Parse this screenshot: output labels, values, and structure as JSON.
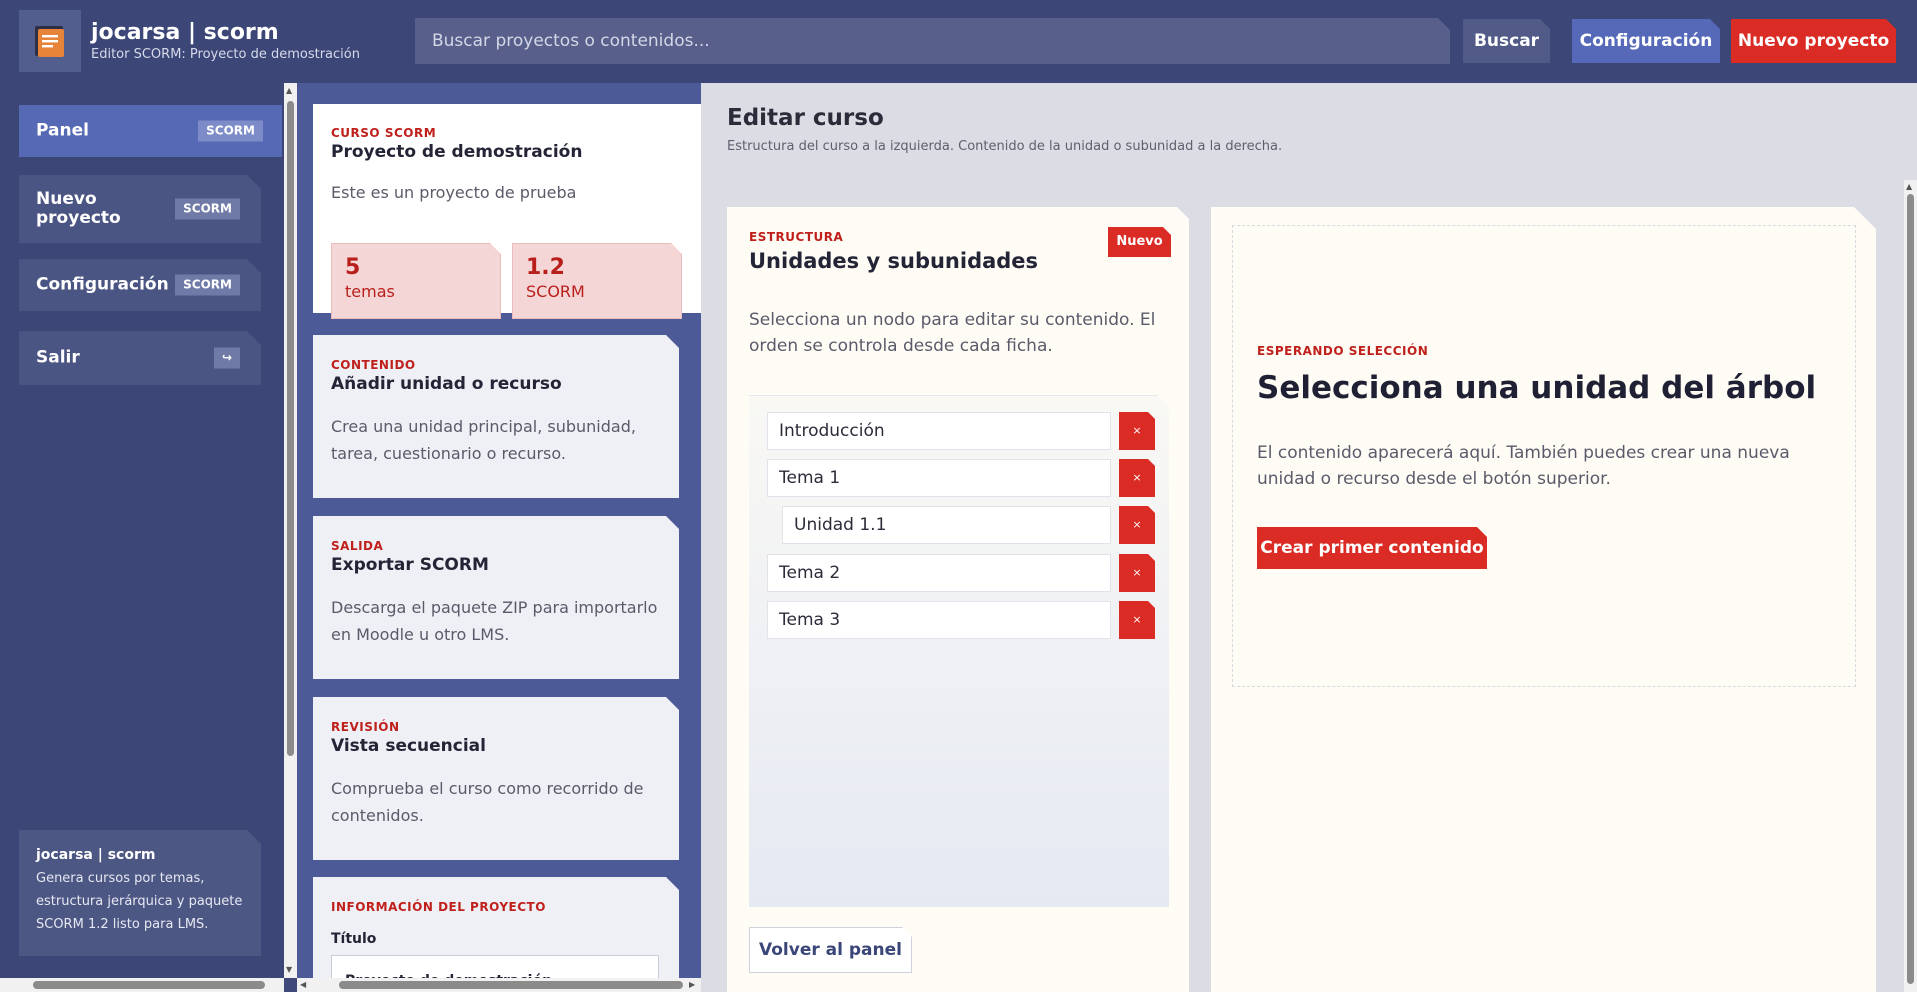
{
  "app": {
    "title": "jocarsa | scorm",
    "subtitle": "Editor SCORM: Proyecto de demostración"
  },
  "header": {
    "search_placeholder": "Buscar proyectos o contenidos...",
    "search_button": "Buscar",
    "config_button": "Configuración",
    "new_project_button": "Nuevo proyecto"
  },
  "sidebar": {
    "items": [
      {
        "label": "Panel",
        "badge": "SCORM",
        "active": true
      },
      {
        "label": "Nuevo proyecto",
        "badge": "SCORM"
      },
      {
        "label": "Configuración",
        "badge": "SCORM"
      },
      {
        "label": "Salir",
        "badge": "↪"
      }
    ],
    "info": {
      "title": "jocarsa | scorm",
      "text": "Genera cursos por temas, estructura jerárquica y paquete SCORM 1.2 listo para LMS."
    }
  },
  "course_card": {
    "eyebrow": "CURSO SCORM",
    "title": "Proyecto de demostración",
    "text": "Este es un proyecto de prueba",
    "stats": [
      {
        "value": "5",
        "label": "temas"
      },
      {
        "value": "1.2",
        "label": "SCORM"
      }
    ]
  },
  "cards": [
    {
      "eyebrow": "CONTENIDO",
      "title": "Añadir unidad o recurso",
      "text": "Crea una unidad principal, subunidad, tarea, cuestionario o recurso."
    },
    {
      "eyebrow": "SALIDA",
      "title": "Exportar SCORM",
      "text": "Descarga el paquete ZIP para importarlo en Moodle u otro LMS."
    },
    {
      "eyebrow": "REVISIÓN",
      "title": "Vista secuencial",
      "text": "Comprueba el curso como recorrido de contenidos."
    }
  ],
  "project_info": {
    "eyebrow": "INFORMACIÓN DEL PROYECTO",
    "field_label": "Título",
    "field_value": "Proyecto de demostración"
  },
  "main": {
    "title": "Editar curso",
    "subtitle": "Estructura del curso a la izquierda. Contenido de la unidad o subunidad a la derecha."
  },
  "structure": {
    "eyebrow": "ESTRUCTURA",
    "title": "Unidades y subunidades",
    "badge": "Nuevo",
    "text": "Selecciona un nodo para editar su contenido. El orden se controla desde cada ficha.",
    "nodes": [
      {
        "label": "Introducción",
        "level": 0
      },
      {
        "label": "Tema 1",
        "level": 0
      },
      {
        "label": "Unidad 1.1",
        "level": 1
      },
      {
        "label": "Tema 2",
        "level": 0
      },
      {
        "label": "Tema 3",
        "level": 0
      }
    ],
    "delete_glyph": "×",
    "back_button": "Volver al panel"
  },
  "content": {
    "eyebrow": "ESPERANDO SELECCIÓN",
    "title": "Selecciona una unidad del árbol",
    "text": "El contenido aparecerá aquí. También puedes crear una nueva unidad o recurso desde el botón superior.",
    "create_button": "Crear primer contenido"
  },
  "colors": {
    "header_bg": "#3c4677",
    "accent_blue": "#5569b8",
    "accent_red": "#da2b24"
  }
}
